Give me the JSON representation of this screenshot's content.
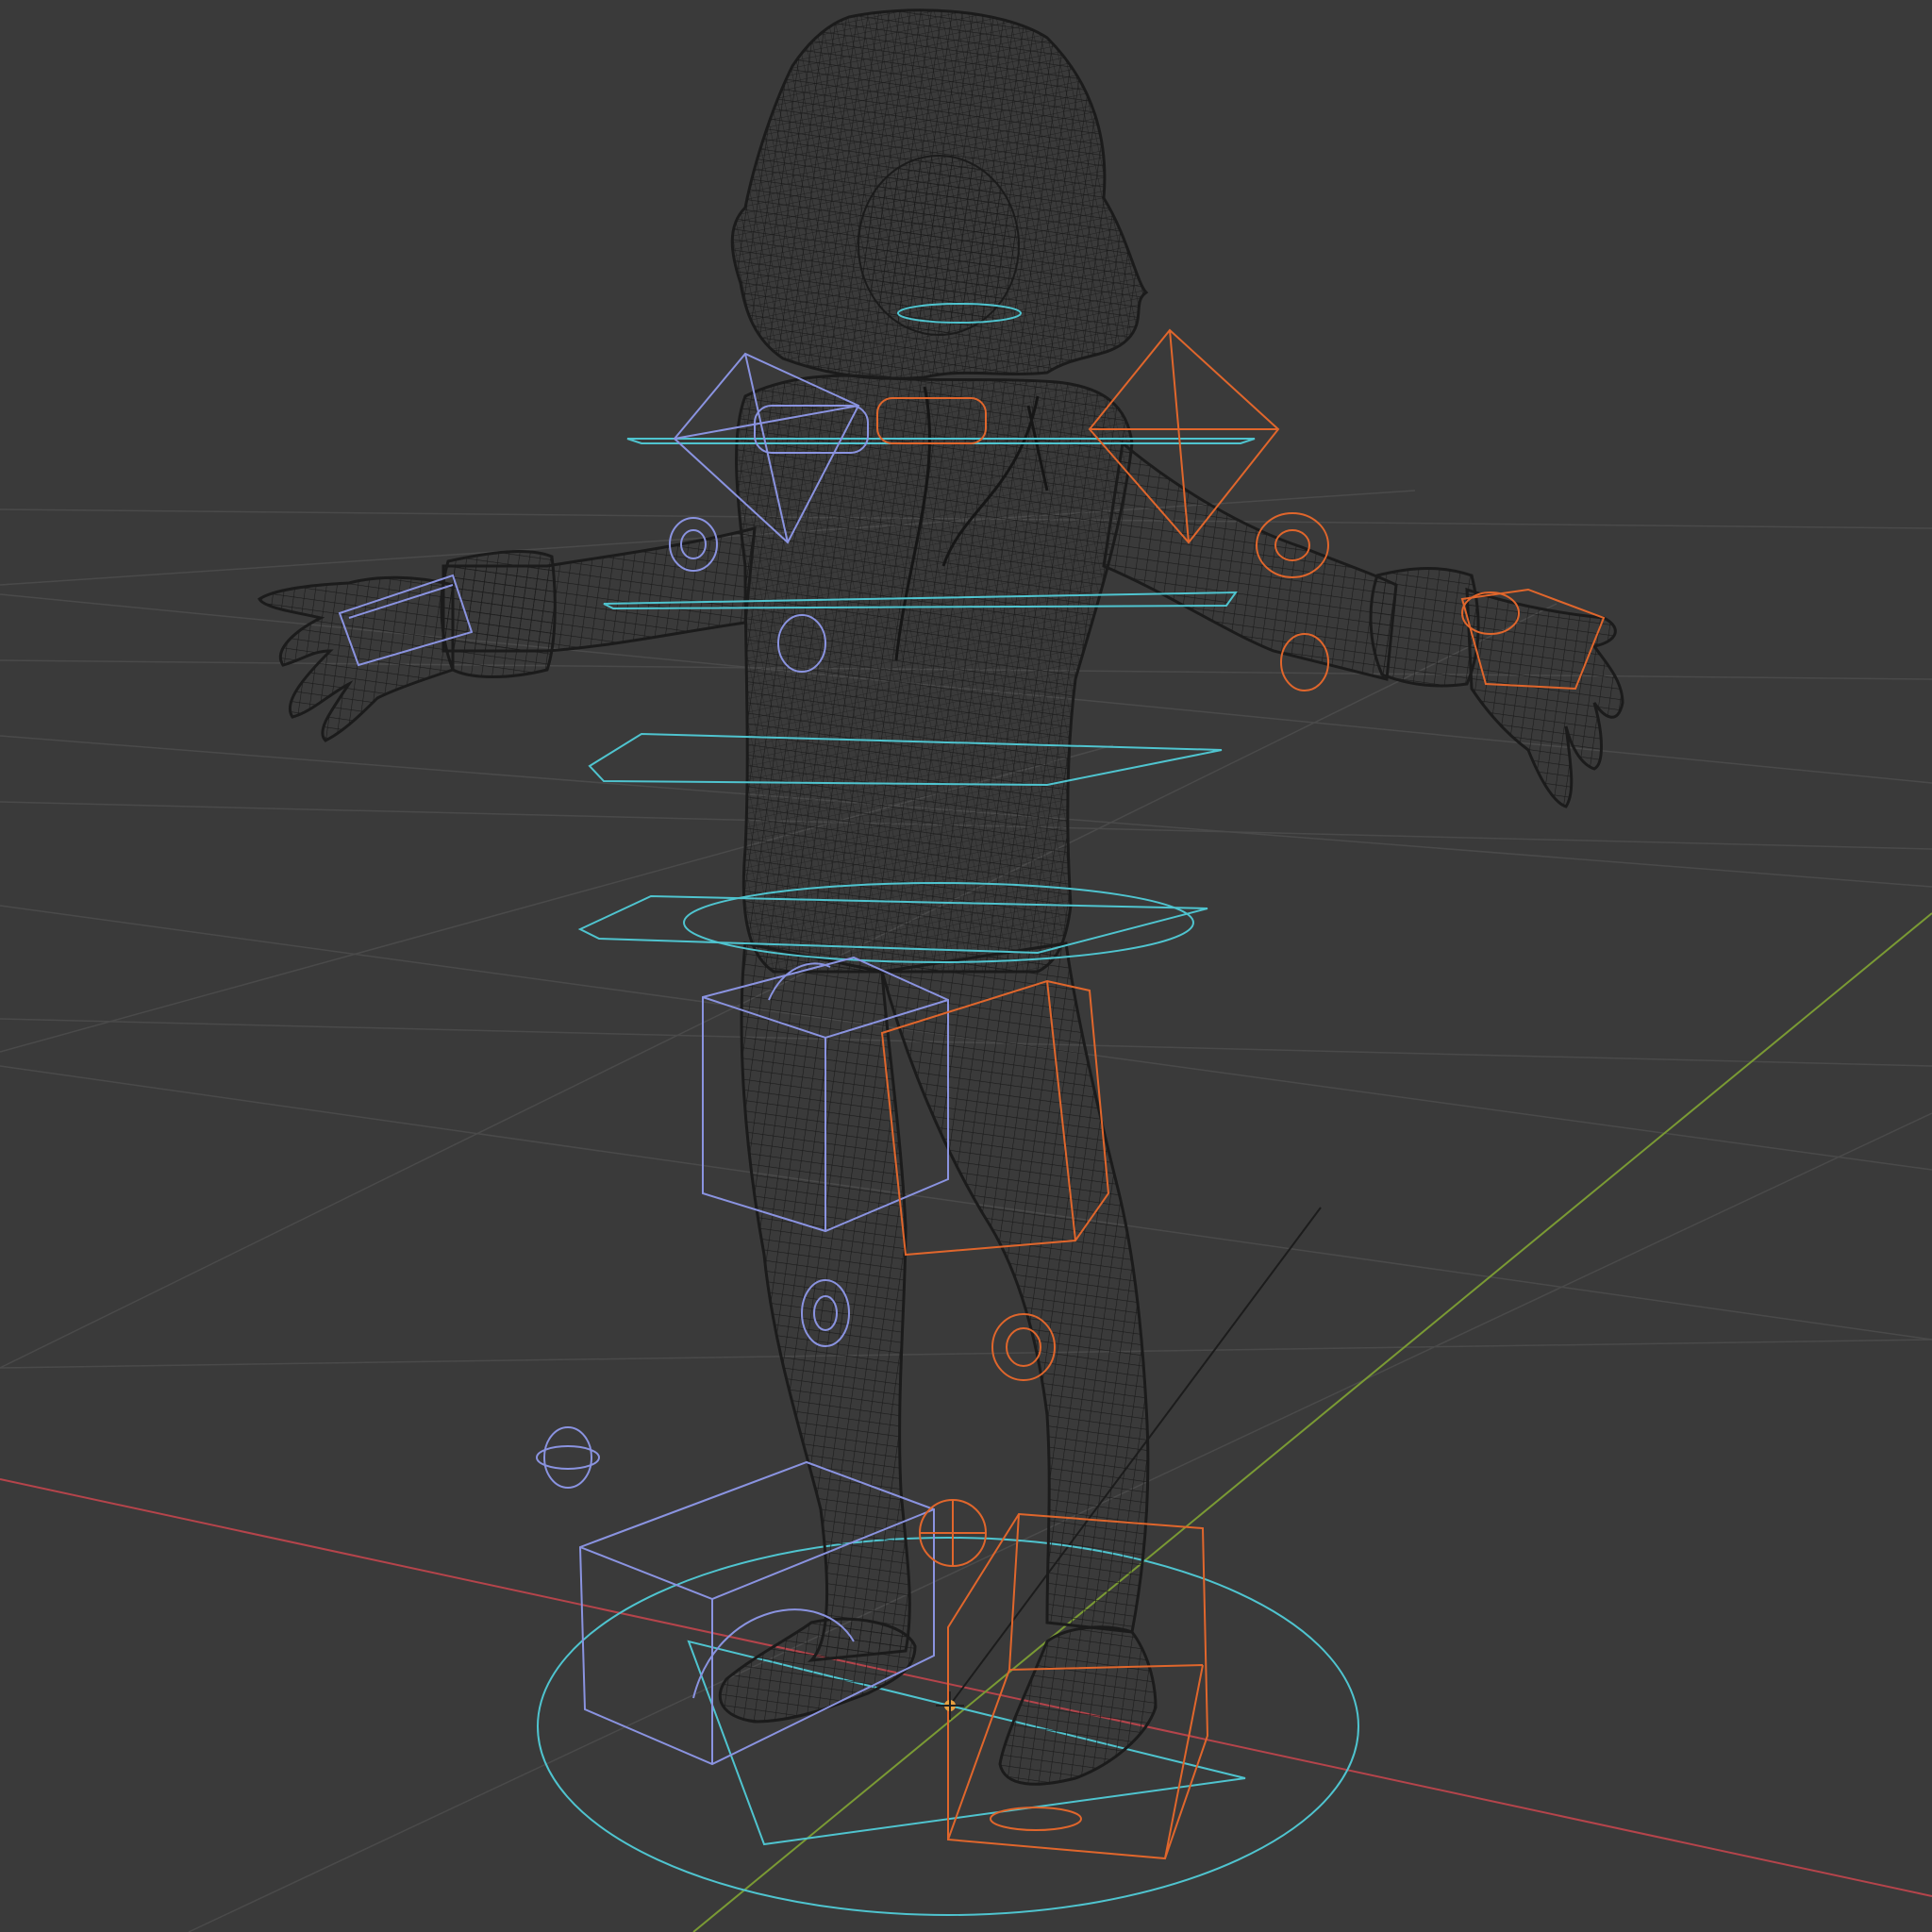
{
  "viewport": {
    "background": "#3a3a3a",
    "grid_color": "#4a4a4a",
    "axis_x_color": "#b5444b",
    "axis_y_color": "#7a9a34",
    "mesh_color": "#1b1b1b",
    "rig_center_color": "#4fc4cf",
    "rig_left_color": "#8a93e0",
    "rig_right_color": "#e0662c",
    "origin_color": "#e8a040"
  },
  "scene": {
    "object": "character-mesh-wireframe",
    "armature": "rig-controls",
    "pose": "T-pose"
  }
}
